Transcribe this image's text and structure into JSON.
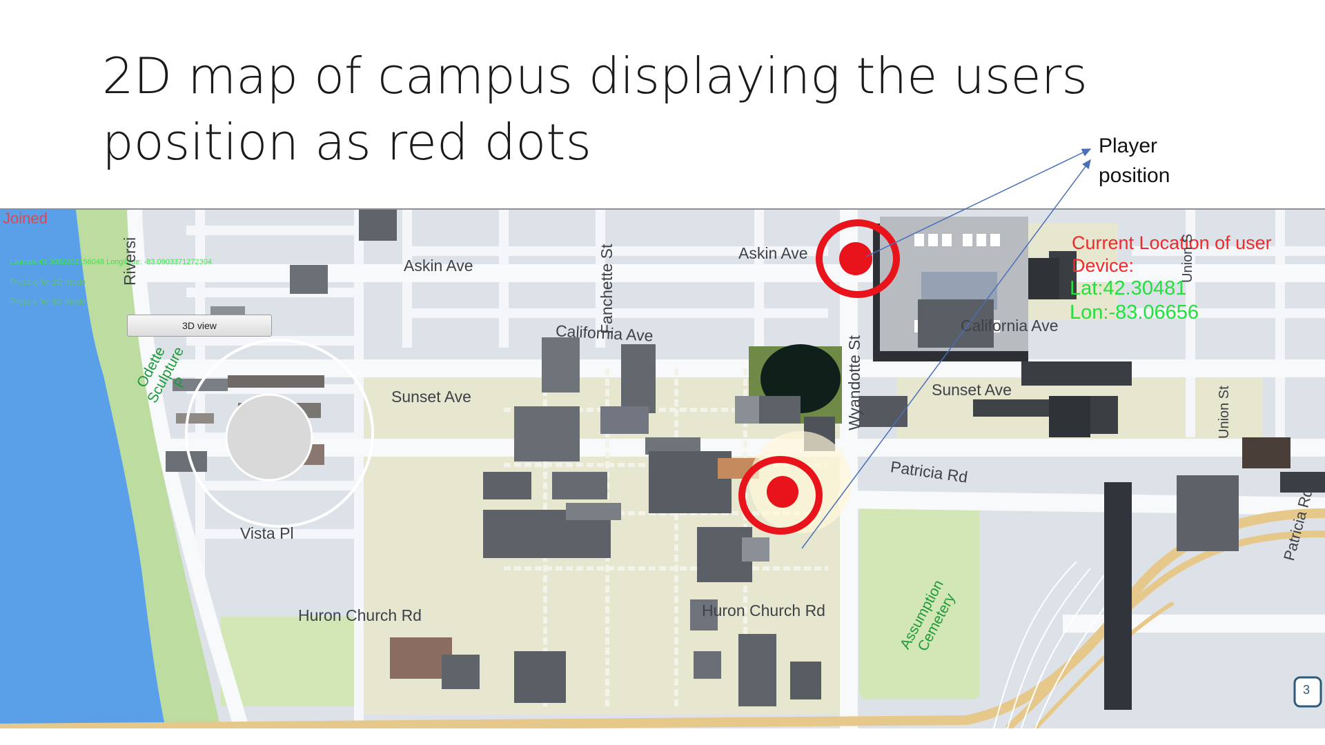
{
  "slide": {
    "title_line1": "2D map of campus displaying the users",
    "title_line2": "position as red dots",
    "callout_line1": "Player",
    "callout_line2": "position"
  },
  "hud": {
    "joined": "Joined",
    "coords": "Latitude:42.3082202156048 Longitude: -83.0903371272304",
    "hint_2d": "Press q for 2D mode",
    "hint_3d": "Press e for 3D mode",
    "view_button": "3D view",
    "location_title_line1": "Current Location of user",
    "location_title_line2": "Device:",
    "lat": "Lat:42.30481",
    "lon": "Lon:-83.06656"
  },
  "streets": {
    "riverside": "Riversi",
    "askin_left": "Askin Ave",
    "askin_right": "Askin Ave",
    "fanchette": "Fanchette St",
    "california_left": "California Ave",
    "california_right": "California Ave",
    "sunset_left": "Sunset Ave",
    "sunset_right": "Sunset Ave",
    "wyandotte": "Wyandotte St",
    "union_top": "Union S",
    "union_mid": "Union St",
    "patricia": "Patricia Rd",
    "patricia_right": "Patricia Rd",
    "vista": "Vista Pl",
    "huron_left": "Huron Church Rd",
    "huron_right": "Huron Church Rd",
    "route": "3"
  },
  "parks": {
    "sculpture_line1": "Odette",
    "sculpture_line2": "Sculpture",
    "sculpture_line3": "P",
    "cemetery_line1": "Assumption",
    "cemetery_line2": "Cemetery"
  },
  "colors": {
    "water": "#5aa0e8",
    "park": "#d3e7b6",
    "campus": "#e7e6cf",
    "road": "#f7f8fa",
    "marker_red": "#e8131b",
    "location_title": "#ee2b2b",
    "coords_green": "#25e03c",
    "arrow": "#4a6fb8"
  }
}
